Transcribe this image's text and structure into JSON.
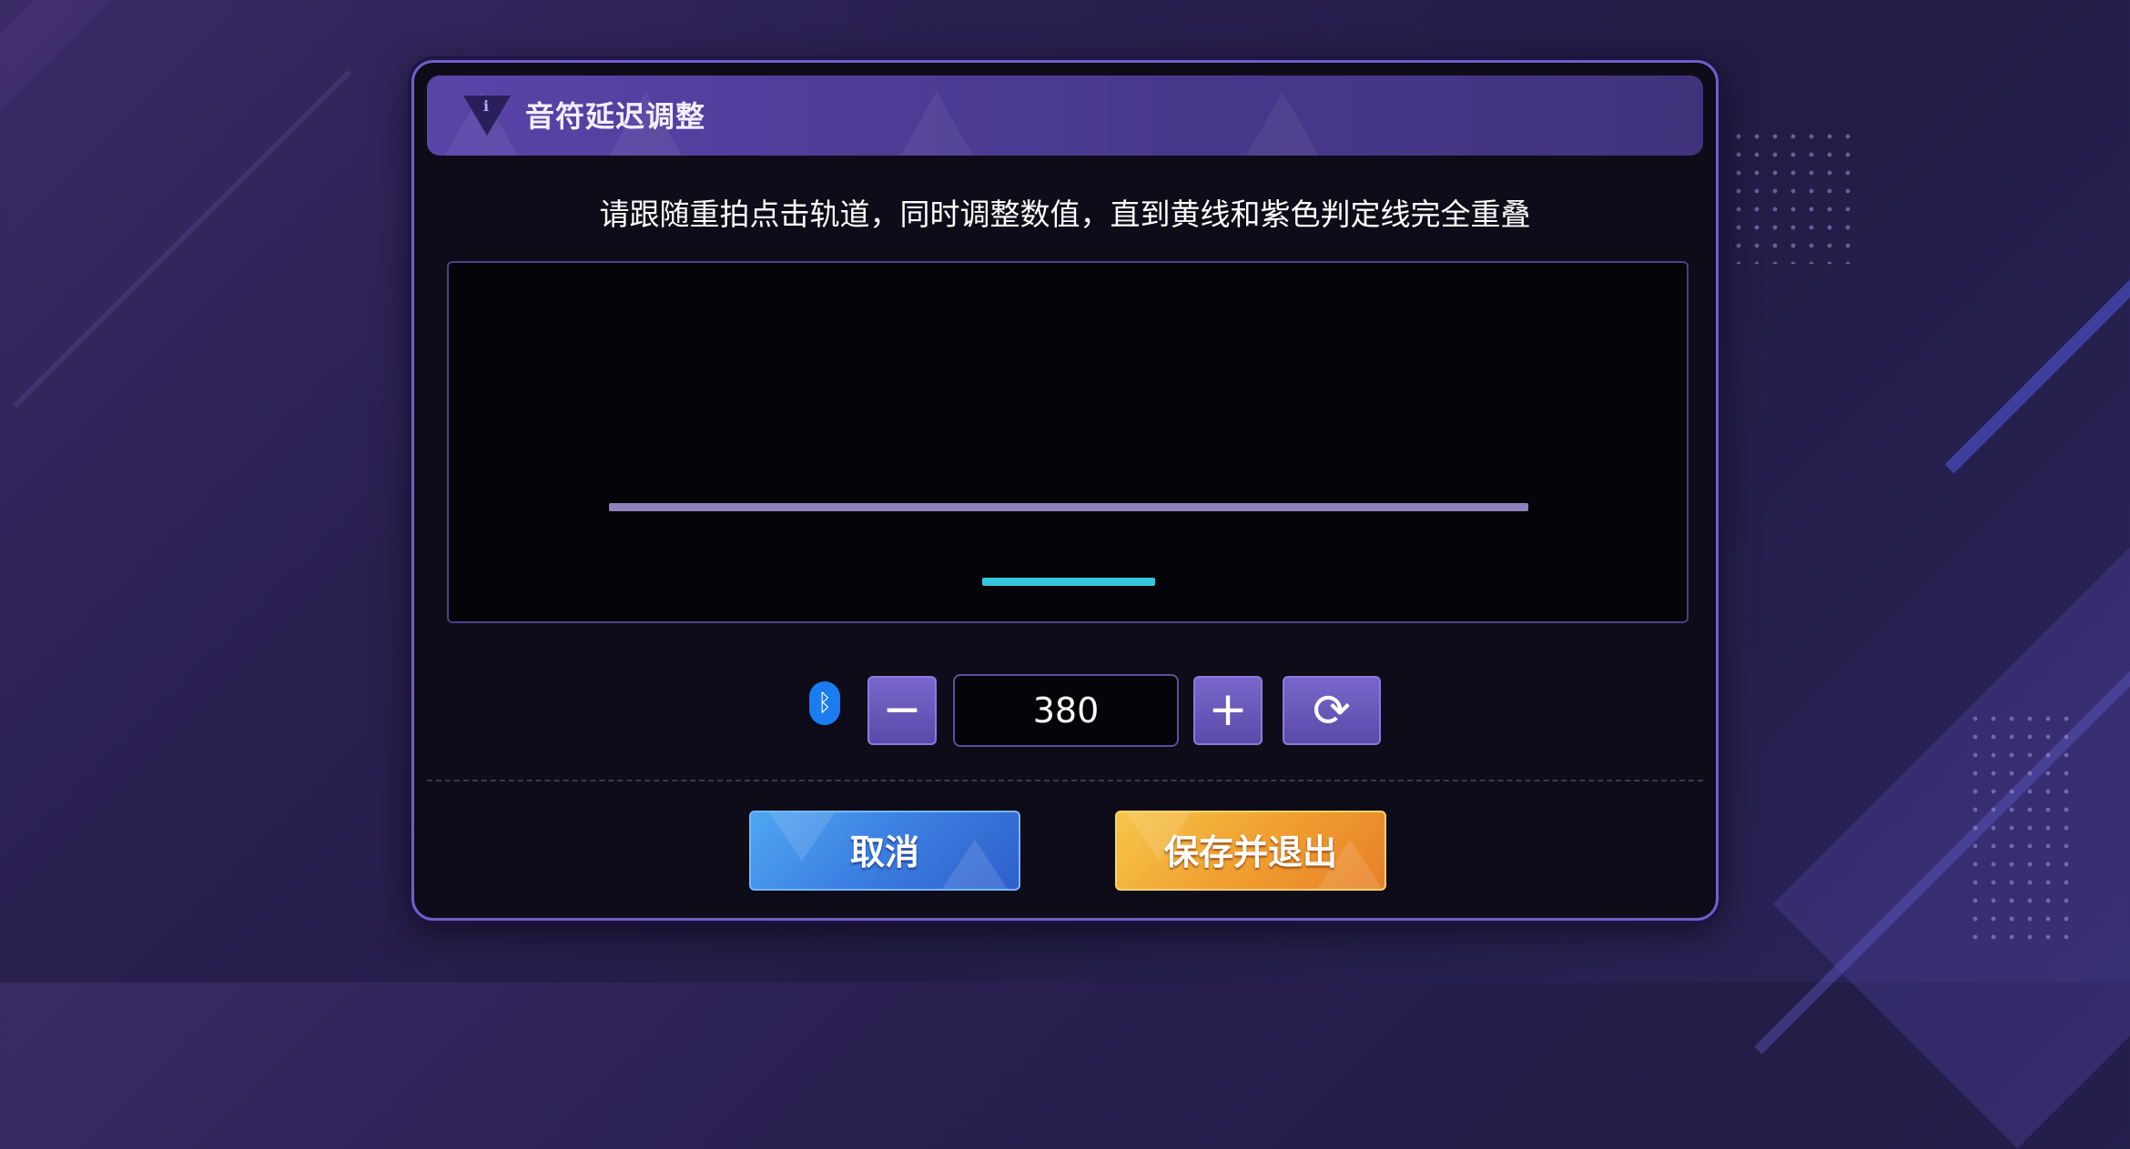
{
  "dialog": {
    "title": "音符延迟调整",
    "info_icon_glyph": "i",
    "instruction": "请跟随重拍点击轨道，同时调整数值，直到黄线和紫色判定线完全重叠"
  },
  "controls": {
    "bluetooth_icon": "bluetooth-icon",
    "minus_label": "−",
    "value": "380",
    "plus_label": "+",
    "reset_label": "⟳"
  },
  "buttons": {
    "cancel": "取消",
    "save_exit": "保存并退出"
  },
  "colors": {
    "judge_line": "#8f82bd",
    "indicator_line": "#35c6dc",
    "cancel_button": "#3b7ee0",
    "save_button": "#f0a030",
    "accent": "#6f5fc8"
  }
}
